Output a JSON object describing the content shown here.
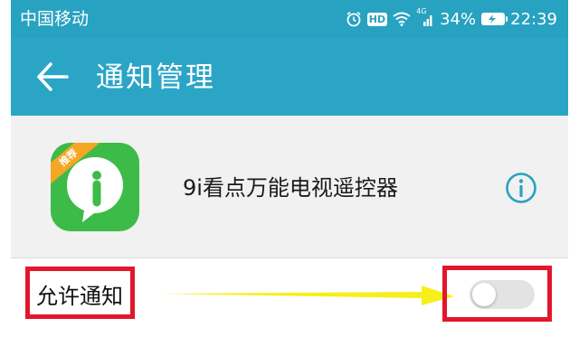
{
  "statusbar": {
    "carrier": "中国移动",
    "hd_badge": "HD",
    "network_tag": "4G",
    "battery_percent": "34%",
    "time": "22:39",
    "icons": [
      "alarm-icon",
      "hd-icon",
      "wifi-icon",
      "signal-icon",
      "battery-icon"
    ]
  },
  "toolbar": {
    "title": "通知管理",
    "back_icon": "arrow-left-icon"
  },
  "app": {
    "name": "9i看点万能电视遥控器",
    "icon": "app-logo-icon",
    "info_icon": "info-icon"
  },
  "settings": {
    "allow_label": "允许通知",
    "allow_enabled": false
  },
  "colors": {
    "accent": "#27a2c0",
    "highlight": "#e3162b",
    "arrow": "#f7ef1b",
    "app_green": "#3dbb49"
  }
}
